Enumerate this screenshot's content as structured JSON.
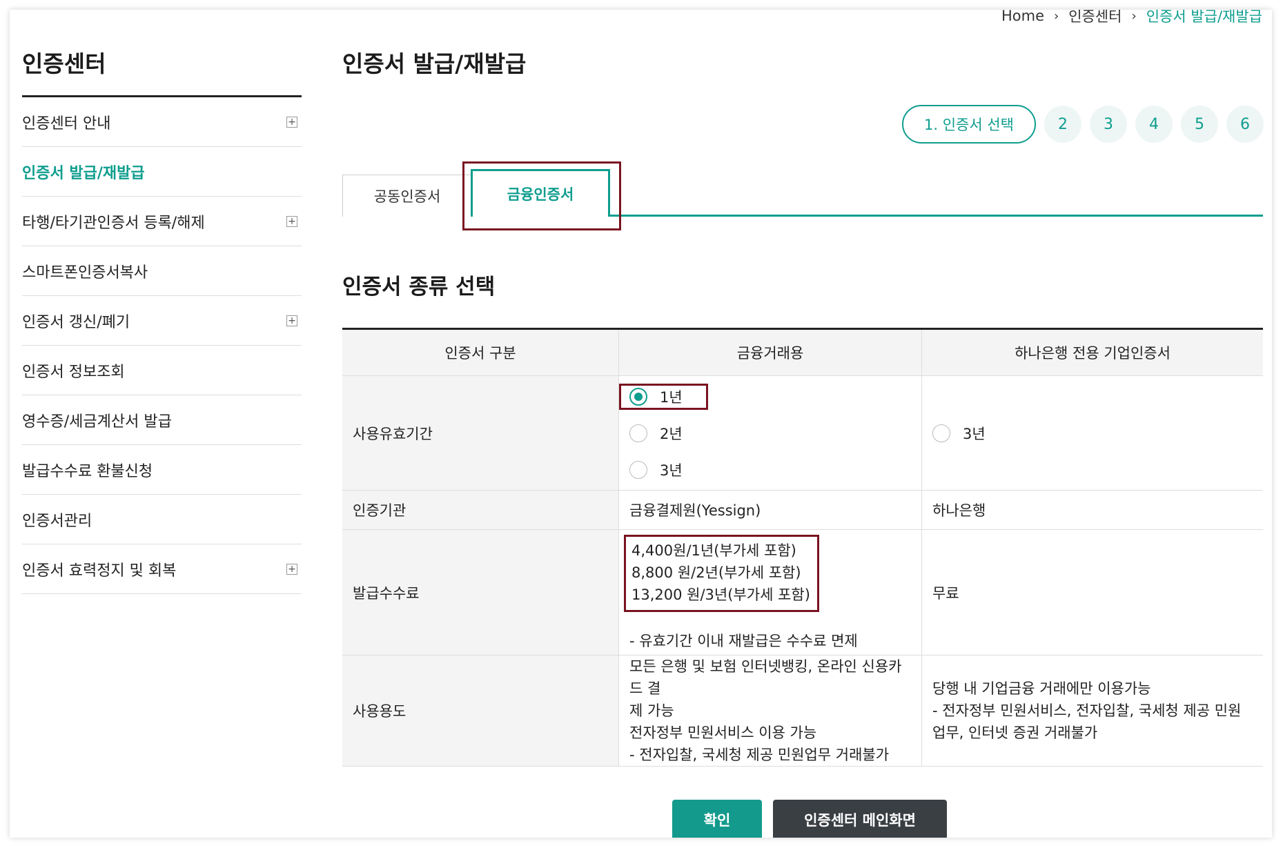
{
  "breadcrumb": {
    "home": "Home",
    "level1": "인증센터",
    "current": "인증서 발급/재발급"
  },
  "sidebar": {
    "title": "인증센터",
    "items": [
      {
        "label": "인증센터 안내"
      },
      {
        "label": "인증서 발급/재발급"
      },
      {
        "label": "타행/타기관인증서 등록/해제"
      },
      {
        "label": "스마트폰인증서복사"
      },
      {
        "label": "인증서 갱신/폐기"
      },
      {
        "label": "인증서 정보조회"
      },
      {
        "label": "영수증/세금계산서 발급"
      },
      {
        "label": "발급수수료 환불신청"
      },
      {
        "label": "인증서관리"
      },
      {
        "label": "인증서 효력정지 및 회복"
      }
    ],
    "expand_symbol": "+"
  },
  "page_title": "인증서 발급/재발급",
  "steps": {
    "current": "1. 인증서 선택",
    "others": [
      "2",
      "3",
      "4",
      "5",
      "6"
    ]
  },
  "tabs": {
    "public": "공동인증서",
    "finance": "금융인증서"
  },
  "section_title": "인증서 종류 선택",
  "table": {
    "headers": [
      "인증서 구분",
      "금융거래용",
      "하나은행 전용 기업인증서"
    ],
    "validity": {
      "label": "사용유효기간",
      "col1_options": [
        "1년",
        "2년",
        "3년"
      ],
      "col1_selected": "1년",
      "col2_options": [
        "3년"
      ]
    },
    "issuer": {
      "label": "인증기관",
      "col1": "금융결제원(Yessign)",
      "col2": "하나은행"
    },
    "fee": {
      "label": "발급수수료",
      "col1_lines": [
        "4,400원/1년(부가세 포함)",
        "8,800 원/2년(부가세 포함)",
        "13,200 원/3년(부가세 포함)"
      ],
      "col1_note": "- 유효기간 이내 재발급은 수수료 면제",
      "col2": "무료"
    },
    "usage": {
      "label": "사용용도",
      "col1_lines": [
        "모든 은행 및 보험 인터넷뱅킹, 온라인 신용카드 결",
        "제 가능",
        "전자정부 민원서비스 이용 가능",
        "- 전자입찰, 국세청 제공 민원업무 거래불가"
      ],
      "col2_lines": [
        "당행 내 기업금융 거래에만 이용가능",
        "- 전자정부 민원서비스, 전자입찰, 국세청 제공 민원",
        "업무, 인터넷 증권 거래불가"
      ]
    }
  },
  "buttons": {
    "confirm": "확인",
    "main": "인증센터 메인화면"
  },
  "colors": {
    "accent": "#0e9d8e",
    "highlight": "#7a1320",
    "dark_button": "#3a3f44"
  }
}
